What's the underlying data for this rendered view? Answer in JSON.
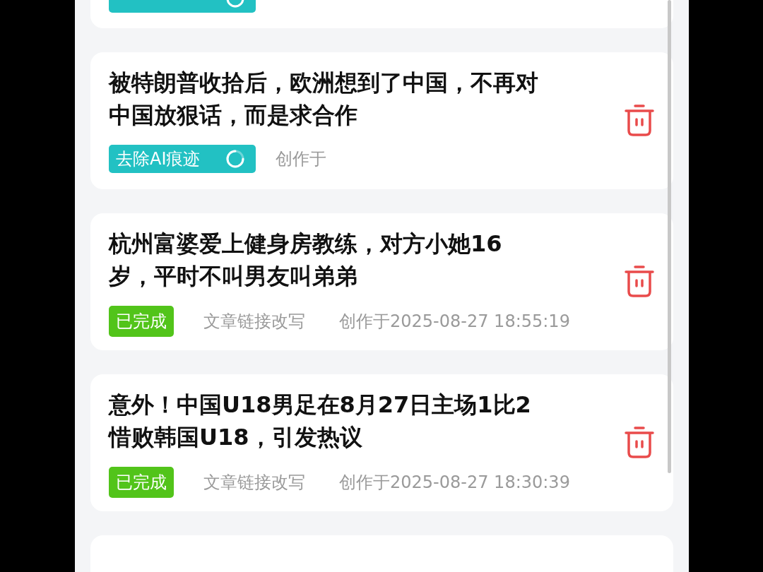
{
  "articles": [
    {
      "status": {
        "kind": "processing"
      }
    },
    {
      "title": "被特朗普收拾后，欧洲想到了中国，不再对中国放狠话，而是求合作",
      "status": {
        "kind": "processing",
        "label": "去除AI痕迹"
      },
      "created_label": "创作于"
    },
    {
      "title": "杭州富婆爱上健身房教练，对方小她16岁，平时不叫男友叫弟弟",
      "status": {
        "kind": "done",
        "label": "已完成"
      },
      "type": "文章链接改写",
      "created": "创作于2025-08-27 18:55:19"
    },
    {
      "title": "意外！中国U18男足在8月27日主场1比2惜败韩国U18，引发热议",
      "status": {
        "kind": "done",
        "label": "已完成"
      },
      "type": "文章链接改写",
      "created": "创作于2025-08-27 18:30:39"
    }
  ]
}
